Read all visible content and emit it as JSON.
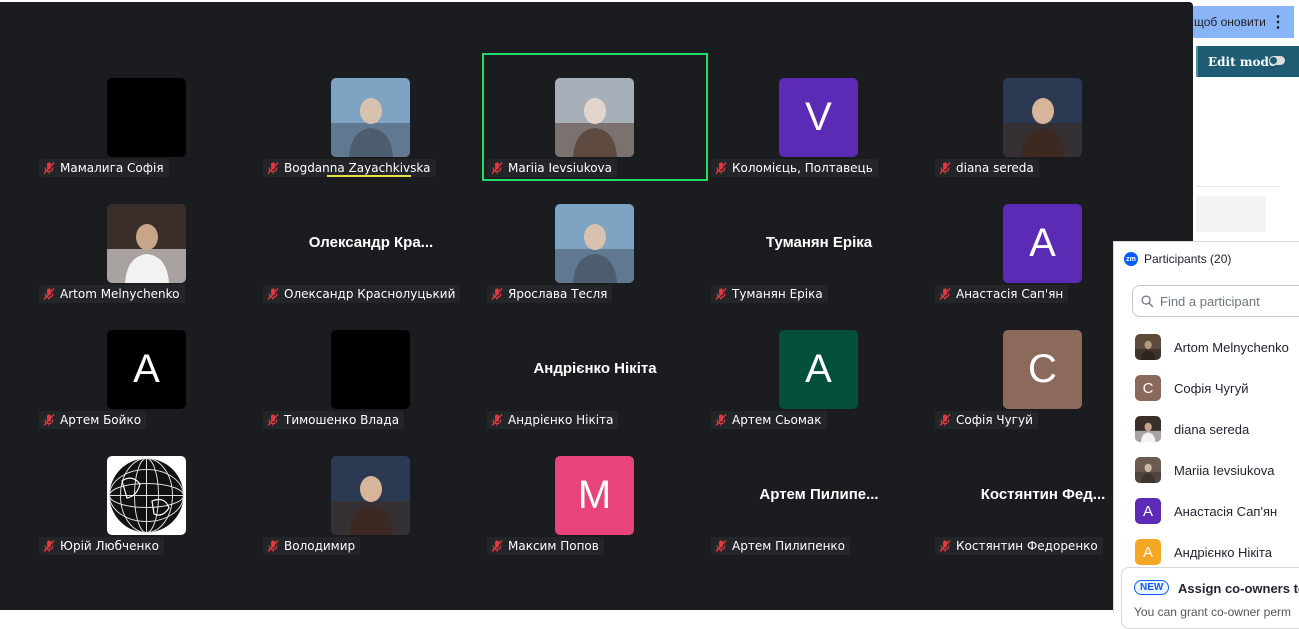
{
  "browser": {
    "update_label": "щоб оновити",
    "edit_mode_label": "Edit mode"
  },
  "gallery": {
    "tiles": [
      {
        "label": "Мамалига Софія",
        "kind": "black"
      },
      {
        "label": "Bogdanna Zayachkivska",
        "kind": "photo",
        "speaking": true
      },
      {
        "label": "Mariia Ievsiukova",
        "kind": "photo",
        "active": true
      },
      {
        "label": "Коломієць, Полтавець",
        "kind": "letter",
        "letter": "V",
        "color": "#5b2bb5"
      },
      {
        "label": "diana sereda",
        "kind": "photo"
      },
      {
        "label": "Artom Melnychenko",
        "kind": "photo"
      },
      {
        "label": "Олександр Краснолуцький",
        "kind": "name",
        "big": "Олександр  Кра..."
      },
      {
        "label": "Ярослава Тесля",
        "kind": "photo"
      },
      {
        "label": "Туманян Еріка",
        "kind": "name",
        "big": "Туманян Еріка"
      },
      {
        "label": "Анастасія Сап'ян",
        "kind": "letter",
        "letter": "A",
        "color": "#5b2bb5"
      },
      {
        "label": "Артем Бойко",
        "kind": "letter",
        "letter": "A",
        "color": "#000000"
      },
      {
        "label": "Тимошенко Влада",
        "kind": "black"
      },
      {
        "label": "Андрієнко Нікіта",
        "kind": "name",
        "big": "Андрієнко Нікіта"
      },
      {
        "label": "Артем Сьомак",
        "kind": "letter",
        "letter": "A",
        "color": "#05503b"
      },
      {
        "label": "Софія Чугуй",
        "kind": "letter",
        "letter": "C",
        "color": "#8b6a5c"
      },
      {
        "label": "Юрій Любченко",
        "kind": "globe"
      },
      {
        "label": "Володимир",
        "kind": "photo"
      },
      {
        "label": "Максим Попов",
        "kind": "letter",
        "letter": "M",
        "color": "#e8437a"
      },
      {
        "label": "Артем Пилипенко",
        "kind": "name",
        "big": "Артем  Пилипе..."
      },
      {
        "label": "Костянтин Федоренко",
        "kind": "name",
        "big": "Костянтин  Фед..."
      }
    ]
  },
  "panel": {
    "title": "Participants (20)",
    "logo": "zm",
    "search_placeholder": "Find a participant",
    "participants": [
      {
        "name": "Artom Melnychenko",
        "kind": "photo"
      },
      {
        "name": "Софія Чугуй",
        "kind": "letter",
        "letter": "C",
        "color": "#8b6a5c"
      },
      {
        "name": "diana sereda",
        "kind": "photo"
      },
      {
        "name": "Mariia Ievsiukova",
        "kind": "photo"
      },
      {
        "name": "Анастасія Сап'ян",
        "kind": "letter",
        "letter": "A",
        "color": "#5b2bb5"
      },
      {
        "name": "Андрієнко Нікіта",
        "kind": "letter",
        "letter": "A",
        "color": "#f5a623"
      }
    ],
    "promo": {
      "badge": "NEW",
      "title": "Assign co-owners to",
      "text": "You can grant co-owner perm"
    }
  },
  "icons": {
    "mic": "muted-microphone-icon",
    "search": "search-icon",
    "menu": "more-vertical-icon"
  }
}
